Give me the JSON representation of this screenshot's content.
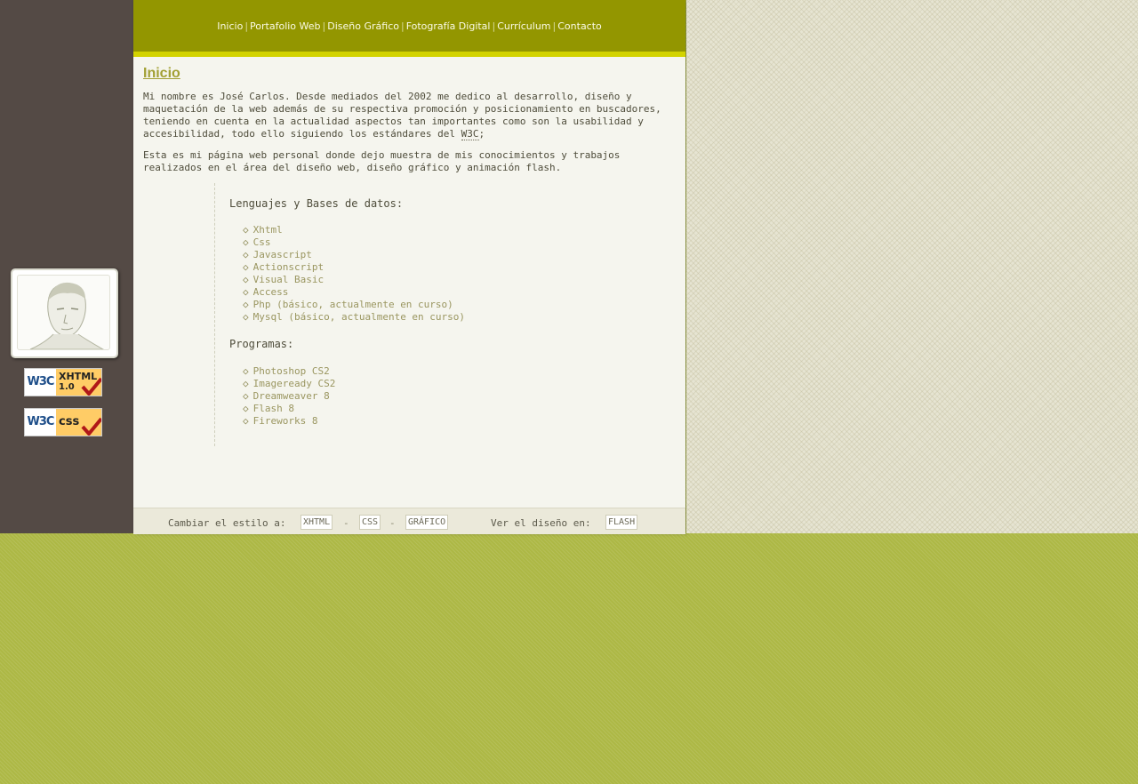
{
  "colors": {
    "header_bg": "#939600",
    "header_bar": "#d3d300",
    "content_bg": "#f5f5ee",
    "left_panel": "#544a45",
    "page_bg": "#adb845",
    "title": "#a2a034"
  },
  "nav": {
    "items": [
      "Inicio",
      "Portafolio Web",
      "Diseño Gráfico",
      "Fotografía Digital",
      "Currículum",
      "Contacto"
    ],
    "separator": "|"
  },
  "main": {
    "title": "Inicio",
    "intro_before": "Mi nombre es José Carlos. Desde mediados del 2002 me dedico al desarrollo, diseño y maquetación de la web además de su respectiva promoción y posicionamiento en buscadores, teniendo en cuenta en la actualidad aspectos tan importantes como son la usabilidad y accesibilidad, todo ello siguiendo los estándares del",
    "intro_link": "W3C",
    "intro_after": ";",
    "paragraph2": "Esta es mi página web personal donde dejo muestra de mis conocimientos y trabajos realizados en el área del diseño web, diseño gráfico y animación flash."
  },
  "skills": {
    "bullet": "◇",
    "languages_title": "Lenguajes y Bases de datos:",
    "languages": [
      "Xhtml",
      "Css",
      "Javascript",
      "Actionscript",
      "Visual Basic",
      "Access",
      "Php (básico, actualmente en curso)",
      "Mysql (básico, actualmente en curso)"
    ],
    "programs_title": "Programas:",
    "programs": [
      "Photoshop CS2",
      "Imageready CS2",
      "Dreamweaver 8",
      "Flash 8",
      "Fireworks 8"
    ]
  },
  "footer": {
    "style_label": "Cambiar el estilo a:",
    "style_options": [
      "XHTML",
      "CSS",
      "GRÁFICO"
    ],
    "dash": "-",
    "view_label": "Ver el diseño en:",
    "view_option": "FLASH"
  },
  "badges": {
    "xhtml": {
      "logo": "W3C",
      "line1": "XHTML",
      "line2": "1.0"
    },
    "css": {
      "logo": "W3C",
      "line1": "css"
    }
  },
  "icons": [
    "avatar-photo",
    "check-icon"
  ]
}
